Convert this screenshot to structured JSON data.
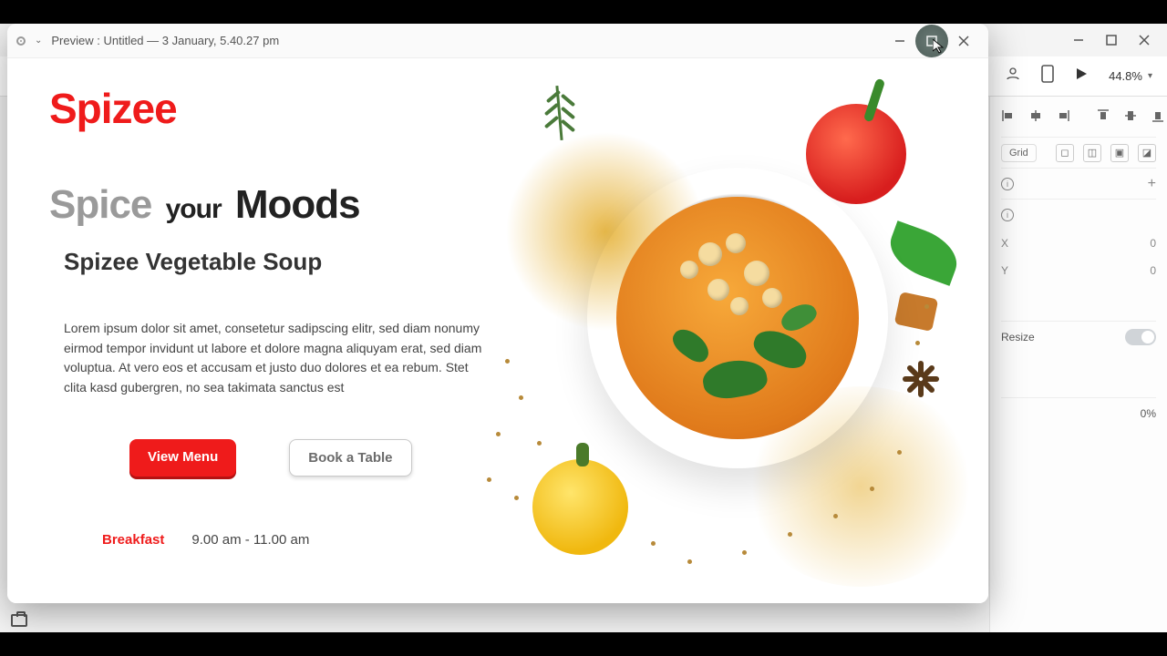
{
  "editor": {
    "zoom": "44.8%",
    "rightPanel": {
      "gridChip": "Grid",
      "x_label": "X",
      "x_value": "0",
      "y_label": "Y",
      "y_value": "0",
      "resize": "Resize",
      "percent": "0%"
    }
  },
  "preview": {
    "title": "Preview : Untitled — 3 January, 5.40.27 pm"
  },
  "page": {
    "logo": "Spizee",
    "headline_grey": "Spice",
    "headline_your": "your",
    "headline_bold": "Moods",
    "subhead": "Spizee Vegetable Soup",
    "description": "Lorem ipsum dolor sit amet, consetetur sadipscing elitr, sed diam nonumy eirmod tempor invidunt ut labore et dolore magna aliquyam erat, sed diam voluptua. At vero eos et accusam et justo duo dolores et ea rebum. Stet clita kasd gubergren, no sea takimata sanctus est",
    "btn_primary": "View Menu",
    "btn_secondary": "Book a Table",
    "meal": "Breakfast",
    "time": "9.00 am - 11.00 am"
  }
}
